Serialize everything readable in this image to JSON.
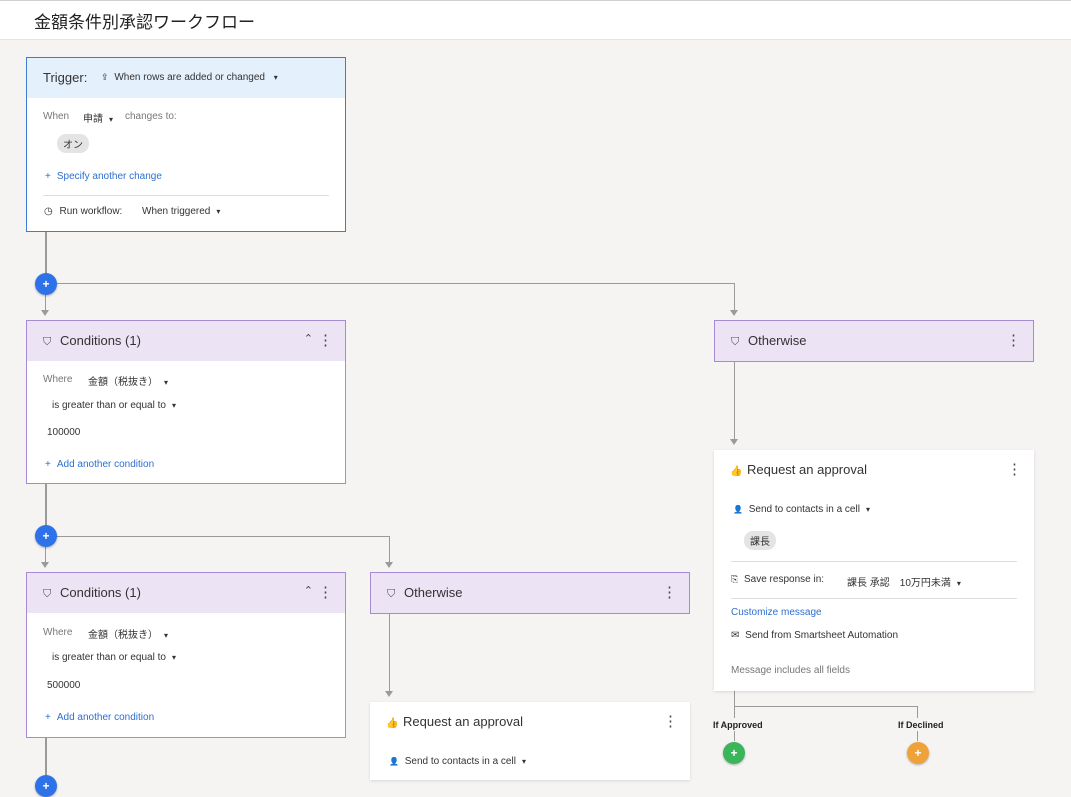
{
  "header": {
    "title": "金額条件別承認ワークフロー"
  },
  "trigger": {
    "label": "Trigger:",
    "type": "When rows are added or changed",
    "when": "When",
    "column": "申請",
    "changes_to": "changes to:",
    "value": "オン",
    "specify_link": "Specify another change",
    "run_label": "Run workflow:",
    "run_value": "When triggered"
  },
  "conditions": [
    {
      "title": "Conditions (1)",
      "where": "Where",
      "field": "金額（税抜き）",
      "operator": "is greater than or equal to",
      "value": "100000",
      "add_link": "Add another condition"
    },
    {
      "title": "Conditions (1)",
      "where": "Where",
      "field": "金額（税抜き）",
      "operator": "is greater than or equal to",
      "value": "500000",
      "add_link": "Add another condition"
    }
  ],
  "otherwise": {
    "title": "Otherwise"
  },
  "approval_right": {
    "title": "Request an approval",
    "send_to": "Send to contacts in a cell",
    "contact": "課長",
    "save_label": "Save response in:",
    "save_value": "課長 承認　10万円未満",
    "customize": "Customize message",
    "send_from": "Send from Smartsheet Automation",
    "message_note": "Message includes all fields"
  },
  "approval_mid": {
    "title": "Request an approval",
    "send_to": "Send to contacts in a cell"
  },
  "branches": {
    "approved": "If Approved",
    "declined": "If Declined"
  },
  "icons": {
    "plus": "+",
    "kebab": "⋮",
    "chevron_up": "⌃",
    "caret": "▾",
    "clock": "◷",
    "person": "👤",
    "envelope": "✉",
    "filter": "⛉",
    "thumb": "👍"
  },
  "colors": {
    "accent": "#2d72e8",
    "condition_header": "#ece3f4",
    "trigger_header": "#e4f0fb",
    "approved": "#3bb55a",
    "declined": "#f0a23a"
  }
}
